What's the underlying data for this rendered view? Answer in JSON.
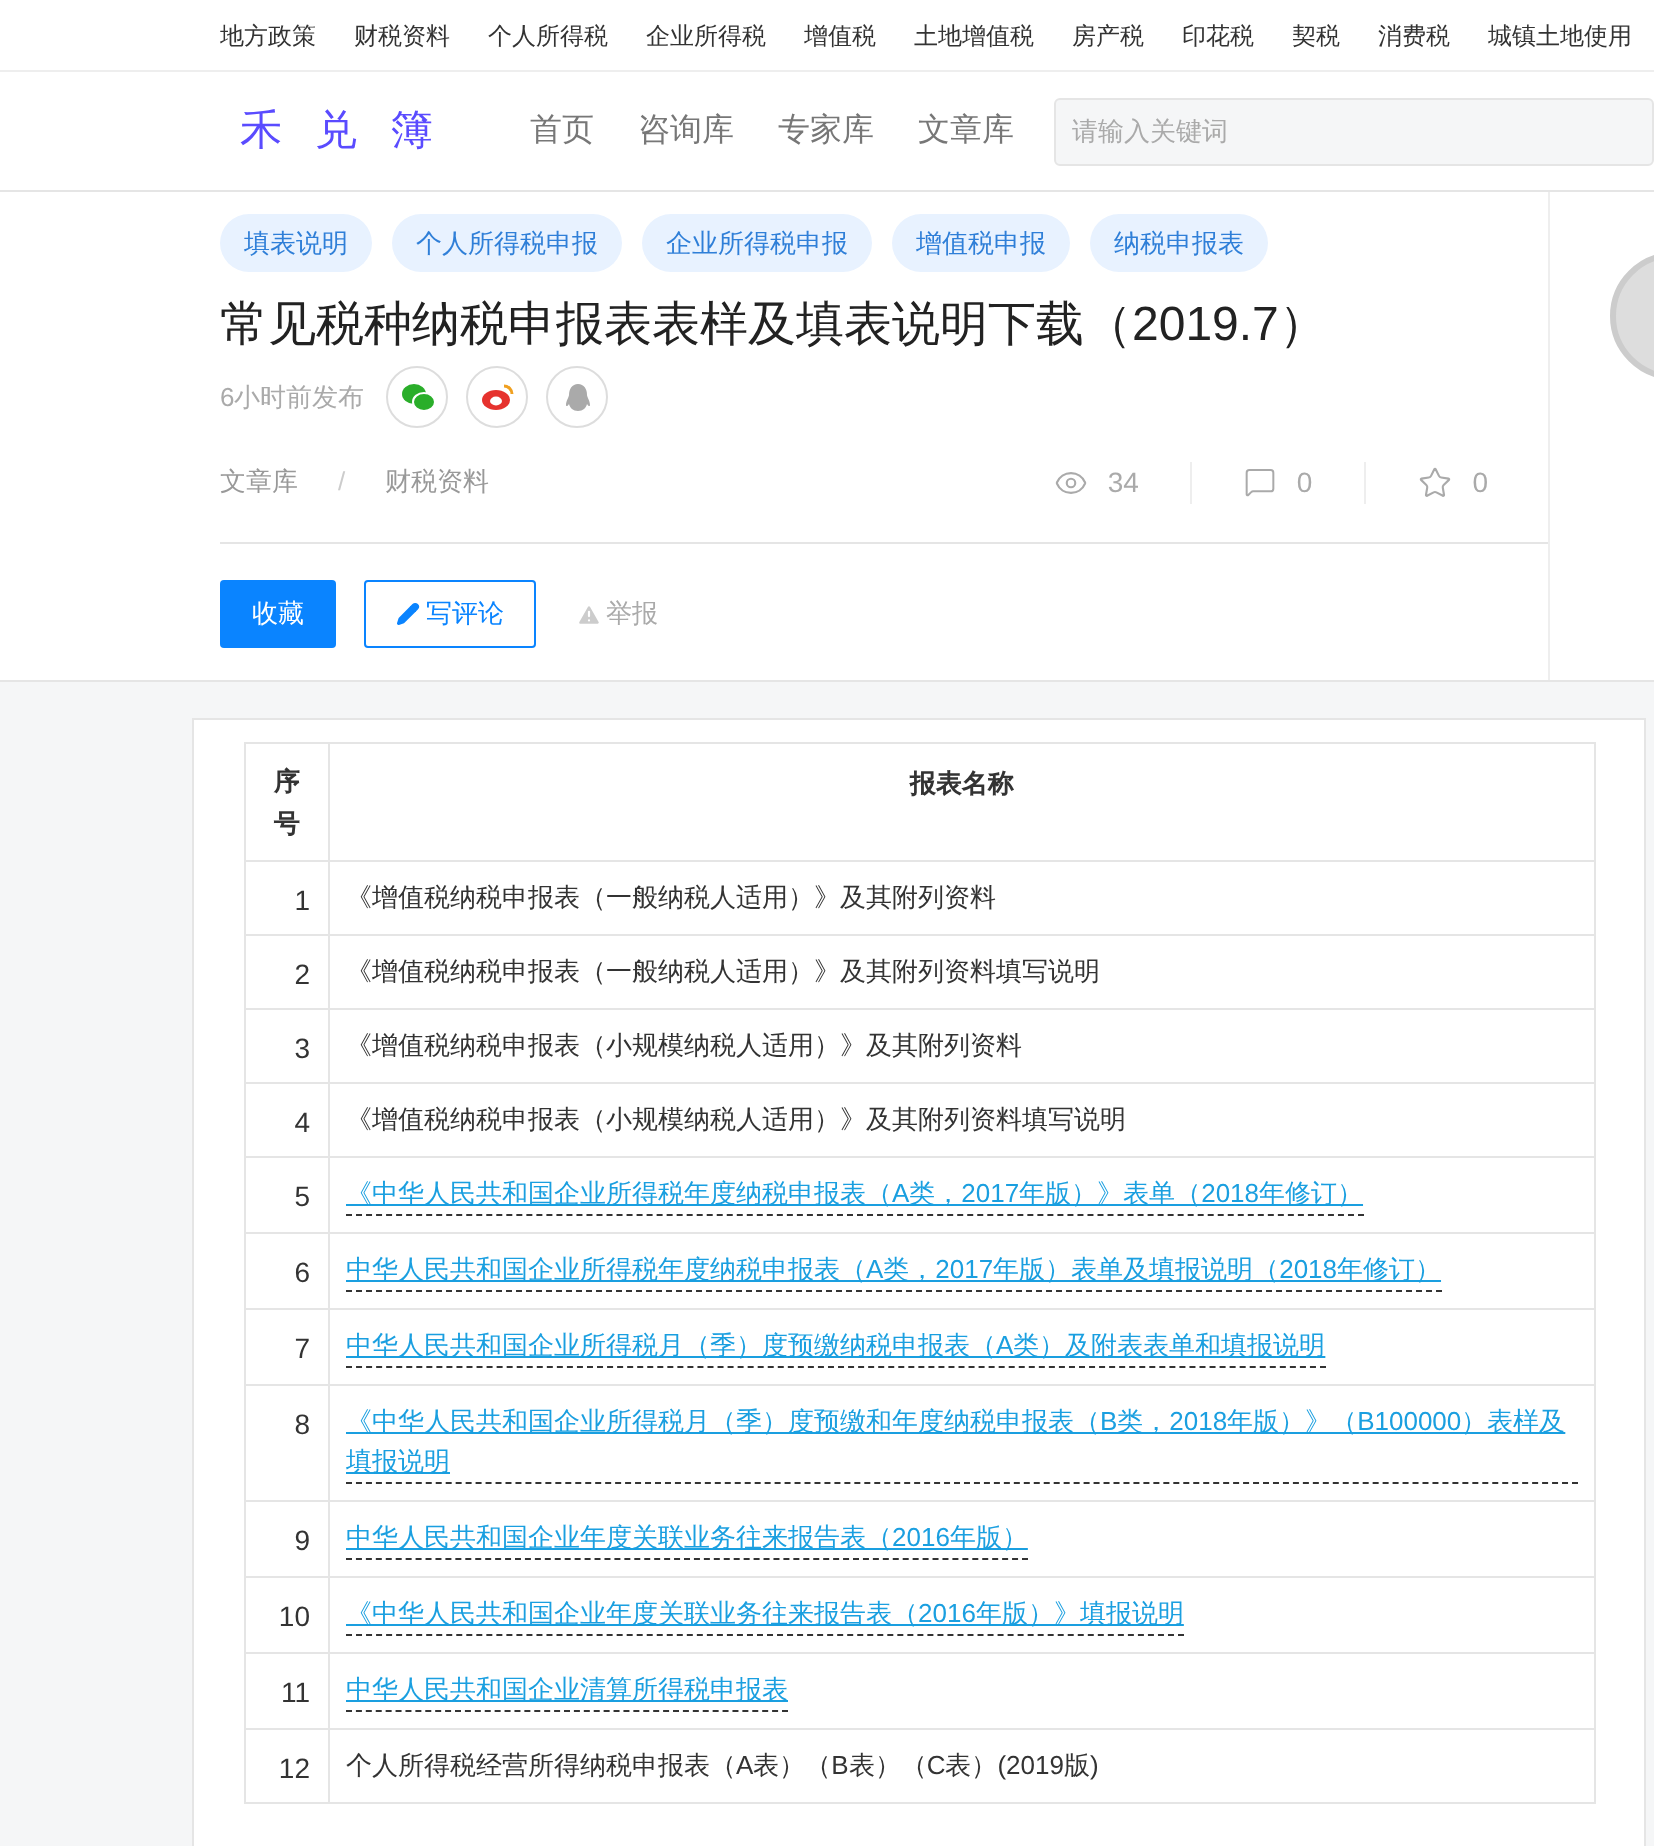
{
  "top_nav": [
    "地方政策",
    "财税资料",
    "个人所得税",
    "企业所得税",
    "增值税",
    "土地增值税",
    "房产税",
    "印花税",
    "契税",
    "消费税",
    "城镇土地使用"
  ],
  "header": {
    "logo": "禾 兑 簿",
    "nav": [
      "首页",
      "咨询库",
      "专家库",
      "文章库"
    ],
    "search": {
      "placeholder": "请输入关键词"
    }
  },
  "article": {
    "tags": [
      "填表说明",
      "个人所得税申报",
      "企业所得税申报",
      "增值税申报",
      "纳税申报表"
    ],
    "title": "常见税种纳税申报表表样及填表说明下载（2019.7）",
    "published": "6小时前发布",
    "breadcrumb": [
      "文章库",
      "财税资料"
    ],
    "breadcrumb_separator": "/",
    "stats": {
      "views": "34",
      "comments": "0",
      "favorites": "0"
    },
    "actions": {
      "favorite": "收藏",
      "comment": "写评论",
      "report": "举报"
    }
  },
  "table": {
    "columns": [
      "序号",
      "报表名称"
    ],
    "rows": [
      {
        "no": "1",
        "name": "《增值税纳税申报表（一般纳税人适用）》及其附列资料",
        "kind": "text"
      },
      {
        "no": "2",
        "name": "《增值税纳税申报表（一般纳税人适用）》及其附列资料填写说明",
        "kind": "text"
      },
      {
        "no": "3",
        "name": "《增值税纳税申报表（小规模纳税人适用）》及其附列资料",
        "kind": "text"
      },
      {
        "no": "4",
        "name": "《增值税纳税申报表（小规模纳税人适用）》及其附列资料填写说明",
        "kind": "text"
      },
      {
        "no": "5",
        "name": "《中华人民共和国企业所得税年度纳税申报表（A类，2017年版）》表单（2018年修订）",
        "kind": "link"
      },
      {
        "no": "6",
        "name": "中华人民共和国企业所得税年度纳税申报表（A类，2017年版）表单及填报说明（2018年修订）",
        "kind": "link"
      },
      {
        "no": "7",
        "name": "中华人民共和国企业所得税月（季）度预缴纳税申报表（A类）及附表表单和填报说明",
        "kind": "link"
      },
      {
        "no": "8",
        "name": "《中华人民共和国企业所得税月（季）度预缴和年度纳税申报表（B类，2018年版）》（B100000）表样及填报说明",
        "kind": "link"
      },
      {
        "no": "9",
        "name": "中华人民共和国企业年度关联业务往来报告表（2016年版）",
        "kind": "link"
      },
      {
        "no": "10",
        "name": "《中华人民共和国企业年度关联业务往来报告表（2016年版）》填报说明",
        "kind": "link"
      },
      {
        "no": "11",
        "name": "中华人民共和国企业清算所得税申报表",
        "kind": "link"
      },
      {
        "no": "12",
        "name": "个人所得税经营所得纳税申报表（A表）（B表）（C表）(2019版)",
        "kind": "text"
      }
    ]
  }
}
